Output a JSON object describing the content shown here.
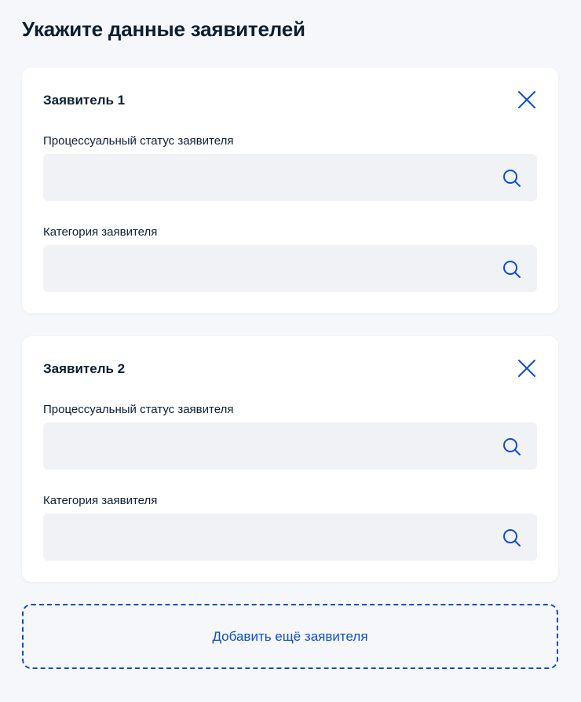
{
  "page": {
    "title": "Укажите данные заявителей"
  },
  "applicants": [
    {
      "title": "Заявитель 1",
      "status_label": "Процессуальный статус заявителя",
      "status_value": "",
      "category_label": "Категория заявителя",
      "category_value": ""
    },
    {
      "title": "Заявитель 2",
      "status_label": "Процессуальный статус заявителя",
      "status_value": "",
      "category_label": "Категория заявителя",
      "category_value": ""
    }
  ],
  "actions": {
    "add_applicant_label": "Добавить ещё заявителя"
  },
  "icons": {
    "close": "close-icon",
    "search": "search-icon"
  },
  "colors": {
    "background": "#f5f7fb",
    "card": "#ffffff",
    "field": "#f1f2f6",
    "accent": "#0d4cd3",
    "text": "#0b1f33"
  }
}
